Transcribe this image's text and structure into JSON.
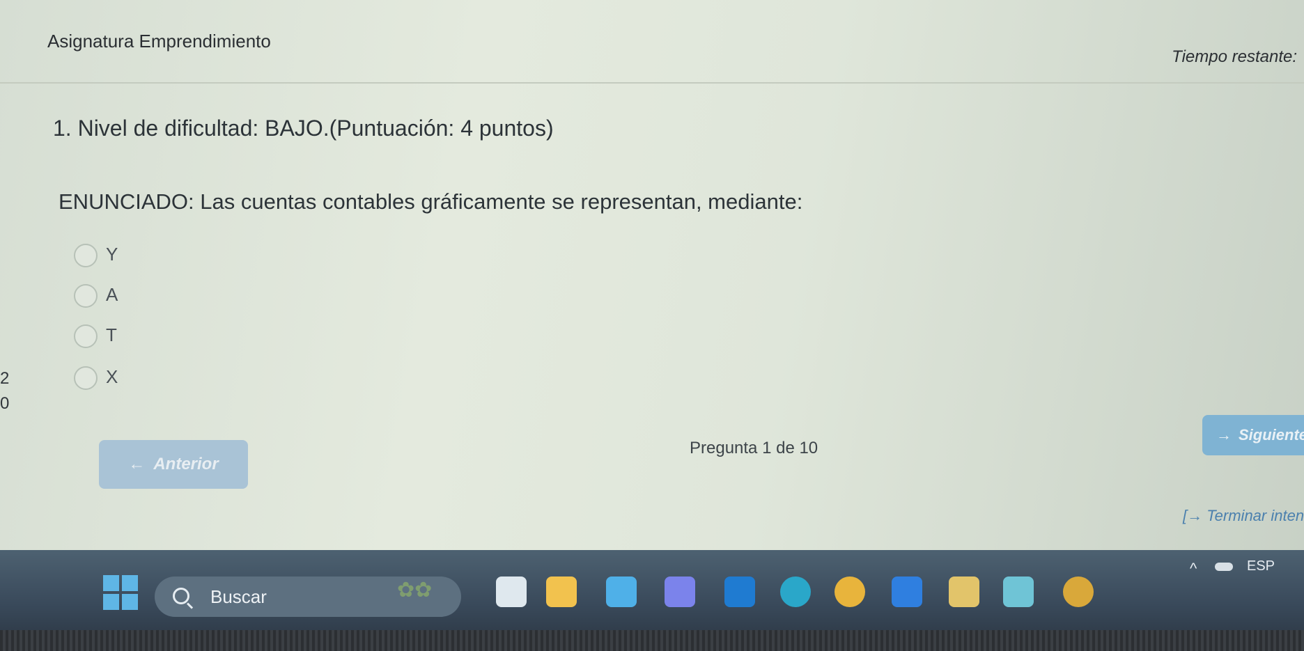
{
  "header": {
    "course_title": "Asignatura Emprendimiento",
    "time_label": "Tiempo restante:"
  },
  "question": {
    "title": "1. Nivel de dificultad: BAJO.(Puntuación: 4 puntos)",
    "stem": "ENUNCIADO: Las cuentas contables gráficamente se representan, mediante:",
    "options": [
      {
        "label": "Y"
      },
      {
        "label": "A"
      },
      {
        "label": "T"
      },
      {
        "label": "X"
      }
    ]
  },
  "edge_numbers": [
    "2",
    "0"
  ],
  "navigation": {
    "prev_label": "Anterior",
    "prev_icon": "arrow-left-icon",
    "next_label": "Siguiente",
    "next_icon": "arrow-right-icon",
    "pager": "Pregunta 1 de 10",
    "finish_label": "Terminar intento",
    "finish_icon": "exit-icon"
  },
  "taskbar": {
    "search_placeholder": "Buscar",
    "language": "ESP",
    "apps": [
      {
        "name": "copilot-icon",
        "color": "#dfe8ee"
      },
      {
        "name": "file-explorer-icon",
        "color": "#f2c24e"
      },
      {
        "name": "store-icon",
        "color": "#4fb0e8"
      },
      {
        "name": "teams-icon",
        "color": "#7b83eb"
      },
      {
        "name": "outlook-icon",
        "color": "#1f7bd1"
      },
      {
        "name": "edge-icon",
        "color": "#2aa7c9"
      },
      {
        "name": "chrome-icon",
        "color": "#e8b43c"
      },
      {
        "name": "dropbox-icon",
        "color": "#2f7fe0"
      },
      {
        "name": "calculator-icon",
        "color": "#e2c46a"
      },
      {
        "name": "check-app-icon",
        "color": "#6fc4d6"
      },
      {
        "name": "chrome-profile-icon",
        "color": "#d9a83a"
      }
    ]
  },
  "colors": {
    "accent": "#7fb3d3",
    "prev_button": "#a9c3d6",
    "finish_link": "#4b80ae"
  }
}
